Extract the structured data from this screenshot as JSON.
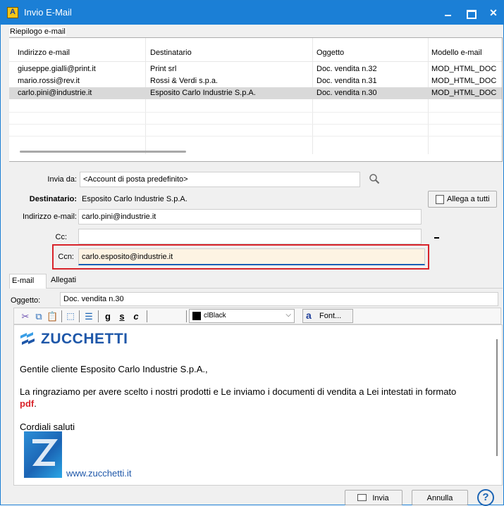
{
  "window": {
    "title": "Invio E-Mail"
  },
  "summary": {
    "group_label": "Riepilogo e-mail",
    "columns": [
      "Indirizzo e-mail",
      "Destinatario",
      "Oggetto",
      "Modello e-mail"
    ],
    "rows": [
      [
        "giuseppe.gialli@print.it",
        "Print srl",
        "Doc. vendita n.32",
        "MOD_HTML_DOC"
      ],
      [
        "mario.rossi@rev.it",
        "Rossi & Verdi s.p.a.",
        "Doc. vendita n.31",
        "MOD_HTML_DOC"
      ],
      [
        "carlo.pini@industrie.it",
        "Esposito Carlo Industrie S.p.A.",
        "Doc. vendita n.30",
        "MOD_HTML_DOC"
      ]
    ],
    "selected_row": 2
  },
  "form": {
    "invia_da_label": "Invia da:",
    "invia_da_value": "<Account di posta predefinito>",
    "destinatario_label": "Destinatario:",
    "destinatario_value": "Esposito Carlo Industrie S.p.A.",
    "allega_label": "Allega a tutti",
    "indirizzo_label": "Indirizzo e-mail:",
    "indirizzo_value": "carlo.pini@industrie.it",
    "cc_label": "Cc:",
    "cc_value": "",
    "ccn_label": "Ccn:",
    "ccn_value": "carlo.esposito@industrie.it",
    "ccn_highlight_color": "#d8232a"
  },
  "tabs": [
    {
      "label": "E-mail",
      "active": true
    },
    {
      "label": "Allegati",
      "active": false
    }
  ],
  "oggetto": {
    "label": "Oggetto:",
    "value": "Doc. vendita n.30"
  },
  "toolbar": {
    "bold": "g",
    "underline": "s",
    "italic": "c",
    "color_value": "clBlack",
    "font_label": "Font..."
  },
  "editor": {
    "logo_text": "ZUCCHETTI",
    "greeting": "Gentile cliente Esposito Carlo Industrie S.p.A.,",
    "body_line1": "La ringraziamo per avere scelto i nostri prodotti e Le inviamo i documenti di vendita a Lei intestati in formato",
    "body_pdf": "pdf",
    "body_dot": ".",
    "closing": "Cordiali saluti",
    "link": "www.zucchetti.it",
    "brand_color": "#1e57a9"
  },
  "buttons": {
    "invia": "Invia",
    "annulla": "Annulla",
    "help": "?"
  }
}
